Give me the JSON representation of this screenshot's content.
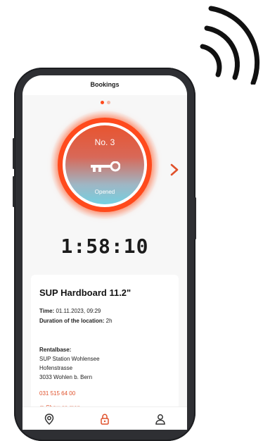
{
  "header": {
    "title": "Bookings"
  },
  "pager": {
    "active_index": 0,
    "count": 2
  },
  "locker": {
    "number_label": "No. 3",
    "status": "Opened",
    "icon": "key-icon"
  },
  "timer": {
    "value": "1:58:10"
  },
  "booking": {
    "title": "SUP Hardboard 11.2\"",
    "time_label": "Time:",
    "time_value": "01.11.2023, 09:29",
    "duration_label": "Duration of the location:",
    "duration_value": "2h",
    "rentalbase_label": "Rentalbase:",
    "address_line1": "SUP Station Wohlensee",
    "address_line2": "Hofenstrasse",
    "address_line3": "3033 Wohlen b. Bern",
    "phone": "031 515 64 00",
    "map_link": "Show on map"
  },
  "tabs": [
    {
      "name": "map",
      "icon": "location-pin-icon",
      "active": false
    },
    {
      "name": "bookings",
      "icon": "lock-icon",
      "active": true
    },
    {
      "name": "profile",
      "icon": "user-icon",
      "active": false
    }
  ],
  "colors": {
    "accent": "#ff4a1c",
    "frame": "#2e2f33",
    "gradient_top": "#e8542f",
    "gradient_bottom": "#74d0e0",
    "dot_active": "#ff4a1c",
    "dot_inactive": "#f2b8a8"
  }
}
